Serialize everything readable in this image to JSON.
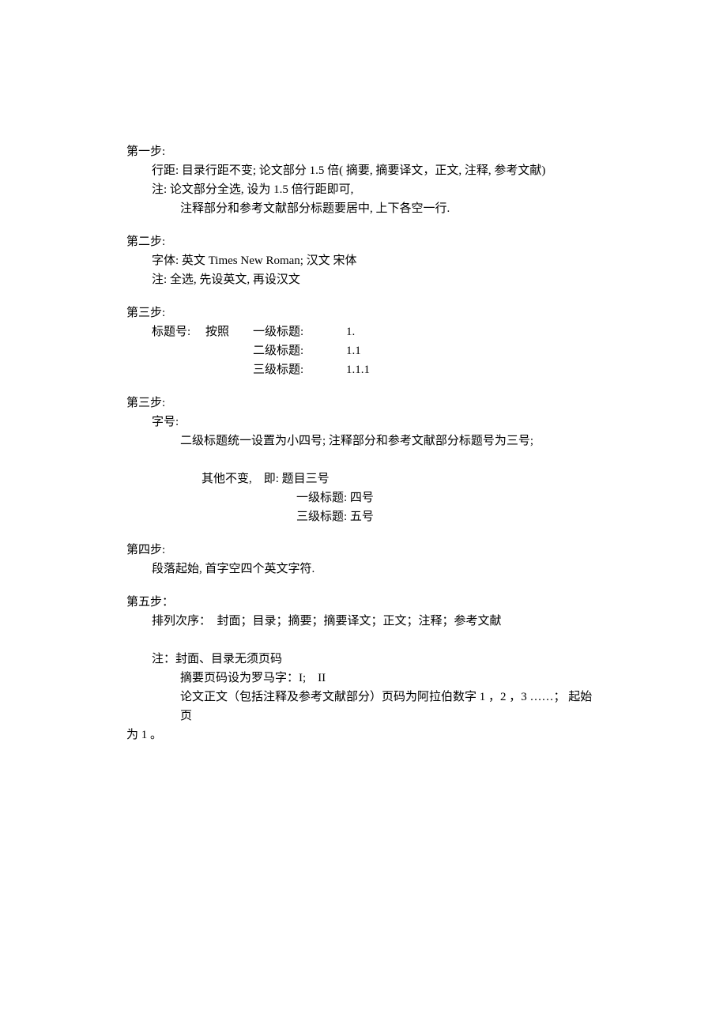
{
  "step1": {
    "heading": "第一步:",
    "line1": "行距: 目录行距不变; 论文部分 1.5 倍( 摘要, 摘要译文，正文, 注释, 参考文献)",
    "line2": "注: 论文部分全选, 设为 1.5 倍行距即可,",
    "line3": "注释部分和参考文献部分标题要居中, 上下各空一行."
  },
  "step2": {
    "heading": "第二步:",
    "line1": "字体: 英文 Times New Roman; 汉文 宋体",
    "line2": "注: 全选, 先设英文, 再设汉文"
  },
  "step3a": {
    "heading": "第三步:",
    "label1": "标题号:",
    "label2": "按照",
    "row1a": "一级标题:",
    "row1b": "1.",
    "row2a": "二级标题:",
    "row2b": "1.1",
    "row3a": "三级标题:",
    "row3b": "1.1.1"
  },
  "step3b": {
    "heading": "第三步:",
    "line1": "字号:",
    "line2": "二级标题统一设置为小四号; 注释部分和参考文献部分标题号为三号;",
    "line3": "其他不变,　即: 题目三号",
    "line4": "一级标题: 四号",
    "line5": "三级标题: 五号"
  },
  "step4": {
    "heading": "第四步:",
    "line1": "段落起始, 首字空四个英文字符."
  },
  "step5": {
    "heading": "第五步：",
    "line1": "排列次序：　封面；目录；摘要；摘要译文；正文；注释；参考文献",
    "line2": "注：封面、目录无须页码",
    "line3": "摘要页码设为罗马字：I;　II",
    "line4": "论文正文（包括注释及参考文献部分）页码为阿拉伯数字 1 ，2 ，3 ……； 起始页",
    "line5": "为 1 。"
  }
}
